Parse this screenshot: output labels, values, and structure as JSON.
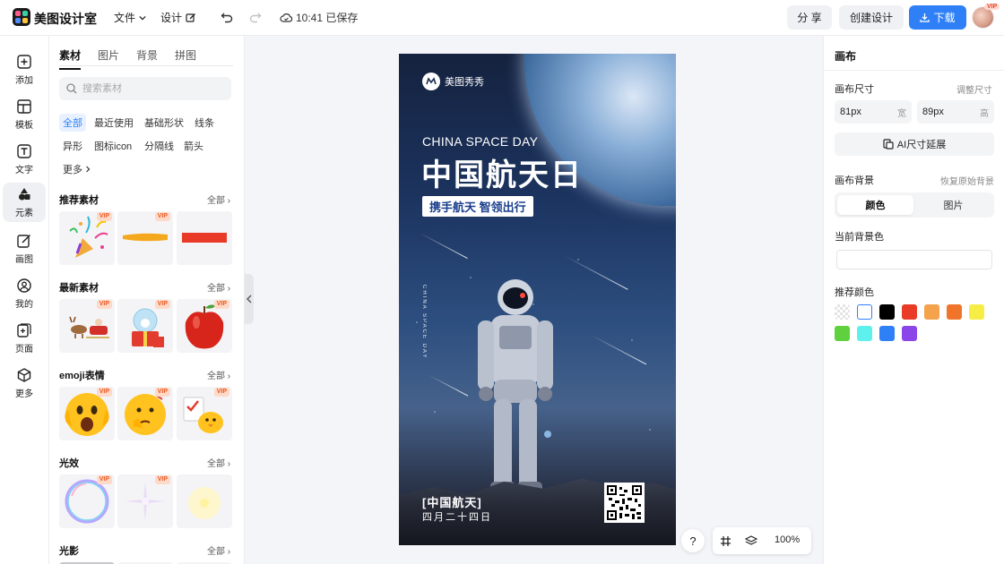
{
  "app": {
    "title": "美图设计室"
  },
  "toolbar": {
    "file_label": "文件",
    "design_label": "设计",
    "save_status": "10:41 已保存",
    "share_label": "分 享",
    "create_label": "创建设计",
    "download_label": "下载",
    "avatar_badge": "VIP"
  },
  "leftnav": {
    "items": [
      {
        "label": "添加",
        "icon": "plus-square-icon"
      },
      {
        "label": "模板",
        "icon": "template-grid-icon"
      },
      {
        "label": "文字",
        "icon": "text-t-icon"
      },
      {
        "label": "元素",
        "icon": "shapes-icon"
      },
      {
        "label": "画图",
        "icon": "draw-pen-icon"
      },
      {
        "label": "我的",
        "icon": "user-icon"
      },
      {
        "label": "页面",
        "icon": "page-add-icon"
      },
      {
        "label": "更多",
        "icon": "cube-icon"
      }
    ],
    "active_index": 3
  },
  "panel": {
    "tabs": [
      "素材",
      "图片",
      "背景",
      "拼图"
    ],
    "active_tab": 0,
    "search_placeholder": "搜索素材",
    "chips": [
      "全部",
      "最近使用",
      "基础形状",
      "线条",
      "异形",
      "图标icon",
      "分隔线",
      "箭头",
      "更多"
    ],
    "active_chip": 0,
    "all_label": "全部",
    "vip_label": "VIP",
    "sections": [
      {
        "title": "推荐素材"
      },
      {
        "title": "最新素材"
      },
      {
        "title": "emoji表情"
      },
      {
        "title": "光效"
      },
      {
        "title": "光影"
      }
    ]
  },
  "poster": {
    "brand": "美图秀秀",
    "english_title": "CHINA SPACE DAY",
    "title": "中国航天日",
    "subtitle": "携手航天 智领出行",
    "vertical_text": "CHINA SPACE DAY",
    "footer_title": "[中国航天]",
    "footer_date": "四月二十四日"
  },
  "canvas_controls": {
    "help_label": "?",
    "zoom": "100%"
  },
  "right": {
    "title": "画布",
    "size_label": "画布尺寸",
    "adjust_link": "调整尺寸",
    "width_value": "81px",
    "width_unit": "宽",
    "height_value": "89px",
    "height_unit": "高",
    "ai_button": "AI尺寸延展",
    "bg_label": "画布背景",
    "restore_link": "恢复原始背景",
    "seg_color": "颜色",
    "seg_image": "图片",
    "current_bg_label": "当前背景色",
    "recommend_label": "推荐颜色",
    "swatches": [
      "transparent",
      "#ffffff",
      "#000000",
      "#ea3b26",
      "#f4a24b",
      "#f0742a",
      "#f7ee45",
      "#5fd13f",
      "#5ef0ec",
      "#2f80f7",
      "#8a46e8"
    ]
  },
  "colors": {
    "accent": "#2f80f7",
    "vip": "#e65a24"
  }
}
